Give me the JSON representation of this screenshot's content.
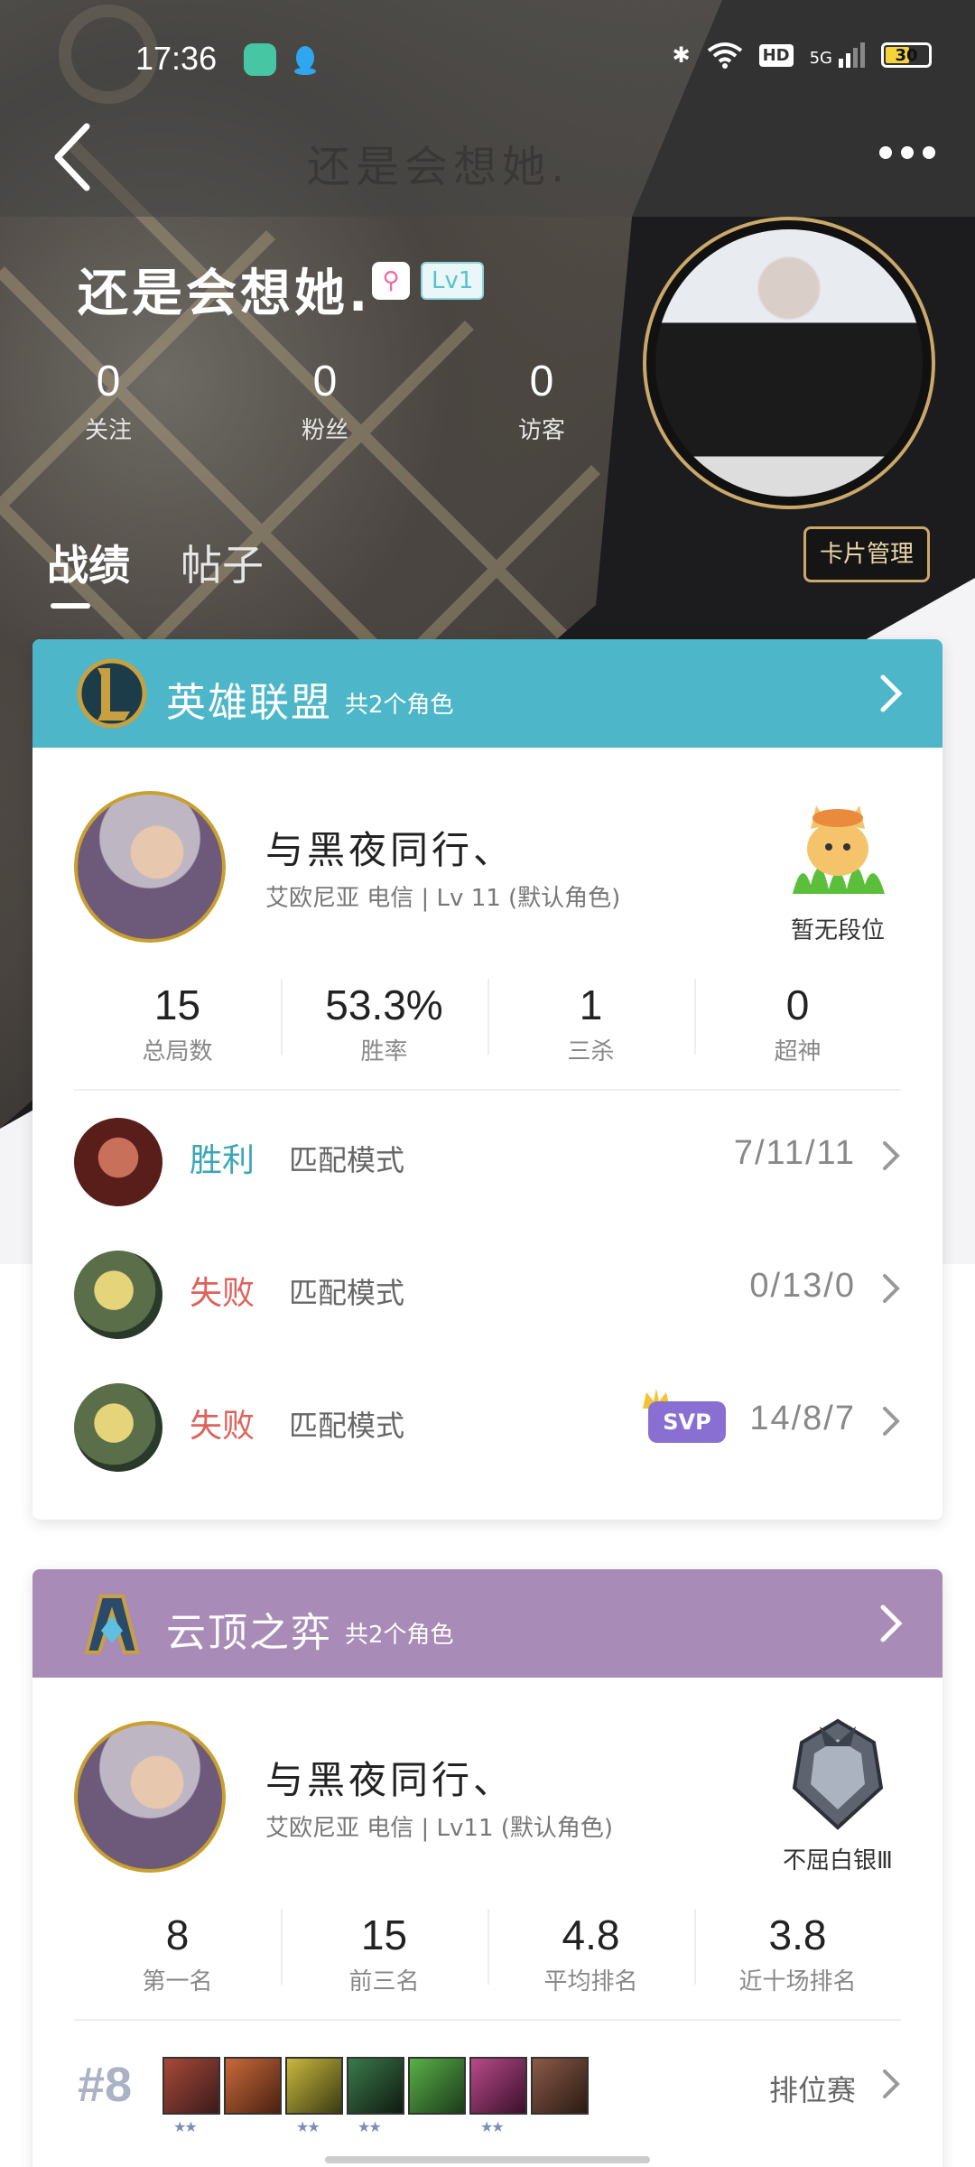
{
  "status_bar": {
    "time": "17:36",
    "network": "5G",
    "hd": "HD",
    "battery": "30"
  },
  "nav": {
    "title": "还是会想她."
  },
  "profile": {
    "username": "还是会想她.",
    "level_badge": "Lv1",
    "stats": [
      {
        "value": "0",
        "label": "关注"
      },
      {
        "value": "0",
        "label": "粉丝"
      },
      {
        "value": "0",
        "label": "访客"
      }
    ],
    "card_manage_label": "卡片管理",
    "tabs": [
      {
        "label": "战绩",
        "active": true
      },
      {
        "label": "帖子",
        "active": false
      }
    ]
  },
  "lol_card": {
    "game_name": "英雄联盟",
    "role_count": "共2个角色",
    "header_color": "#4db7c9",
    "role": {
      "name": "与黑夜同行、",
      "meta": "艾欧尼亚 电信 | Lv 11 (默认角色)",
      "rank_label": "暂无段位"
    },
    "stats": [
      {
        "value": "15",
        "label": "总局数"
      },
      {
        "value": "53.3%",
        "label": "胜率"
      },
      {
        "value": "1",
        "label": "三杀"
      },
      {
        "value": "0",
        "label": "超神"
      }
    ],
    "matches": [
      {
        "result": "胜利",
        "result_color": "#3aa7b9",
        "mode": "匹配模式",
        "kda": "7/11/11",
        "svp": false
      },
      {
        "result": "失败",
        "result_color": "#e0605a",
        "mode": "匹配模式",
        "kda": "0/13/0",
        "svp": false
      },
      {
        "result": "失败",
        "result_color": "#e0605a",
        "mode": "匹配模式",
        "kda": "14/8/7",
        "svp": true,
        "svp_label": "SVP"
      }
    ]
  },
  "tft_card": {
    "game_name": "云顶之弈",
    "role_count": "共2个角色",
    "header_color": "#a98bb8",
    "role": {
      "name": "与黑夜同行、",
      "meta": "艾欧尼亚 电信 | Lv11 (默认角色)",
      "rank_label": "不屈白银Ⅲ"
    },
    "stats": [
      {
        "value": "8",
        "label": "第一名"
      },
      {
        "value": "15",
        "label": "前三名"
      },
      {
        "value": "4.8",
        "label": "平均排名"
      },
      {
        "value": "3.8",
        "label": "近十场排名"
      }
    ],
    "last_game": {
      "placement": "#8",
      "queue": "排位赛",
      "champion_stars": [
        2,
        0,
        2,
        2,
        0,
        2,
        0
      ]
    }
  }
}
